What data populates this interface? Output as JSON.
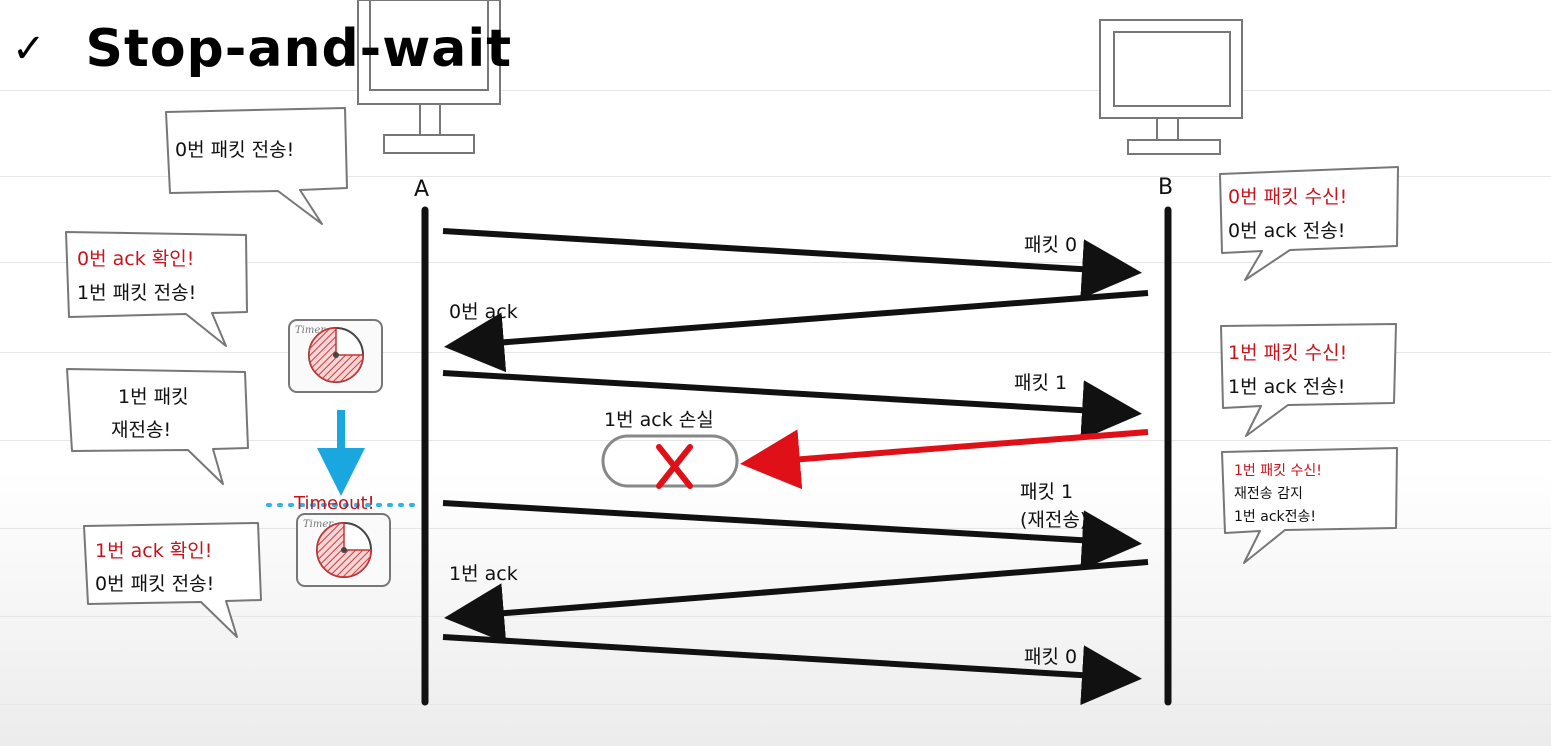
{
  "title": "Stop-and-wait",
  "hosts": {
    "a_label": "A",
    "b_label": "B"
  },
  "arrows": {
    "packet0": "패킷 0",
    "ack0": "0번 ack",
    "packet1": "패킷 1",
    "ack1_lost": "1번 ack 손실",
    "packet1_retx_line1": "패킷 1",
    "packet1_retx_line2": "(재전송)",
    "ack1": "1번 ack",
    "packet0_again": "패킷 0"
  },
  "timeout_label": "Timeout!",
  "bubbles": {
    "a_send0": [
      "0번 패킷 전송!"
    ],
    "a_ack0": [
      "0번 ack 확인!",
      "1번 패킷 전송!"
    ],
    "a_retx": [
      "1번 패킷",
      "재전송!"
    ],
    "a_ack1": [
      "1번 ack 확인!",
      "0번 패킷 전송!"
    ],
    "b_recv0": [
      "0번 패킷 수신!",
      "0번 ack 전송!"
    ],
    "b_recv1": [
      "1번 패킷 수신!",
      "1번 ack 전송!"
    ],
    "b_dup": [
      "1번 패킷 수신!",
      "재전송 감지",
      "1번 ack전송!"
    ]
  },
  "timer_label": "Timer",
  "colors": {
    "line": "#111111",
    "lost": "#e01018",
    "timeout_arrow": "#1aa7e0",
    "highlight": "#c8141c",
    "dotted": "#2fb4e6"
  },
  "icons": [
    "check-icon",
    "computer-a-icon",
    "computer-b-icon",
    "timer-icon",
    "lost-x-icon",
    "timeout-arrow-icon"
  ]
}
